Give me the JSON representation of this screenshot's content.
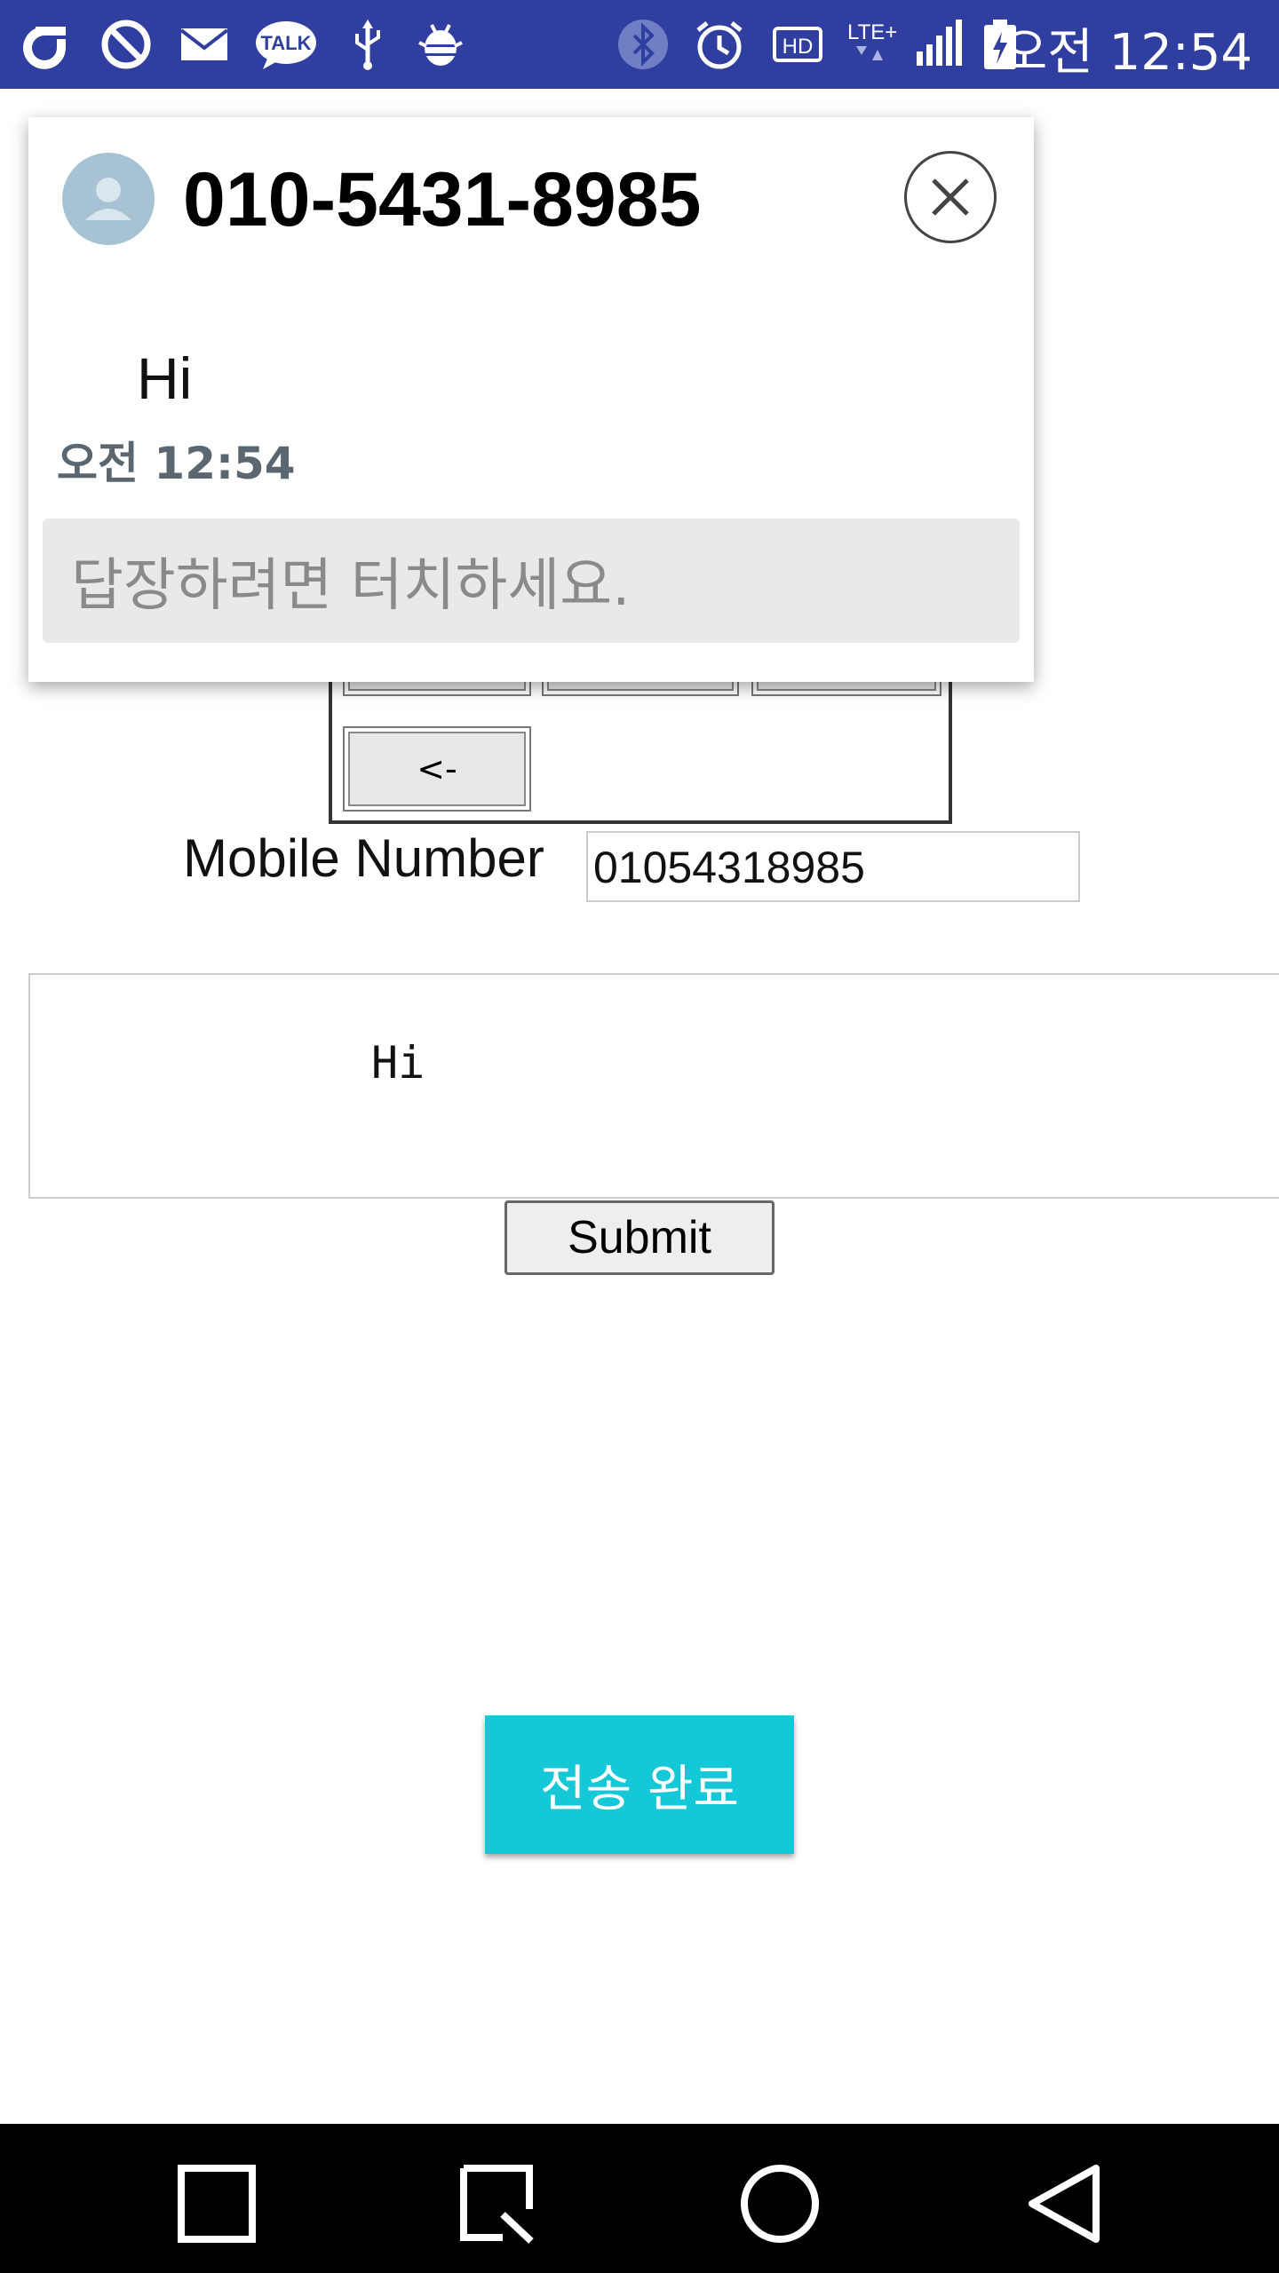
{
  "status_bar": {
    "time": "오전 12:54",
    "icons": [
      "carrier-icon",
      "blocked-icon",
      "mail-icon",
      "talk-icon",
      "usb-icon",
      "android-debug-icon",
      "bluetooth-icon",
      "alarm-icon",
      "hd-icon",
      "lte-icon",
      "signal-icon",
      "battery-icon"
    ],
    "talk_label": "TALK",
    "hd_label": "HD",
    "lte_label": "LTE+",
    "color": "#303f9f"
  },
  "keypad": {
    "back_label": "<-"
  },
  "form": {
    "mobile_label": "Mobile Number",
    "mobile_value": "01054318985",
    "message_value": "Hi",
    "submit_label": "Submit"
  },
  "done_button": {
    "label": "전송 완료",
    "color": "#14c8d8"
  },
  "popup": {
    "title": "010-5431-8985",
    "message": "Hi",
    "time": "오전 12:54",
    "reply_placeholder": "답장하려면 터치하세요."
  },
  "nav_bar": {
    "icons": [
      "recents-icon",
      "capture-icon",
      "home-icon",
      "back-icon"
    ]
  }
}
